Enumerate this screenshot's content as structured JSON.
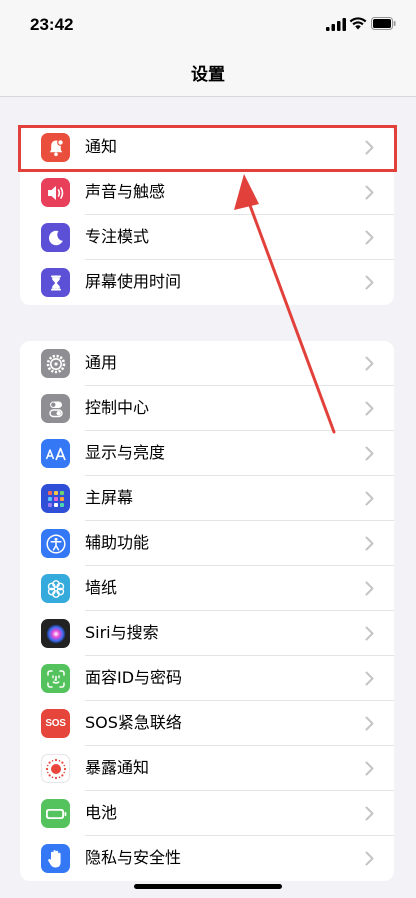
{
  "status_bar": {
    "time": "23:42"
  },
  "nav": {
    "title": "设置"
  },
  "groups": [
    {
      "items": [
        {
          "label": "通知",
          "icon": "bell-icon",
          "color": "#ea4e3d"
        },
        {
          "label": "声音与触感",
          "icon": "speaker-icon",
          "color": "#e8405a"
        },
        {
          "label": "专注模式",
          "icon": "moon-icon",
          "color": "#5b50d6"
        },
        {
          "label": "屏幕使用时间",
          "icon": "hourglass-icon",
          "color": "#5b50d6"
        }
      ]
    },
    {
      "items": [
        {
          "label": "通用",
          "icon": "gear-icon",
          "color": "#8e8e93"
        },
        {
          "label": "控制中心",
          "icon": "toggles-icon",
          "color": "#8e8e93"
        },
        {
          "label": "显示与亮度",
          "icon": "text-size-icon",
          "color": "#3478f6"
        },
        {
          "label": "主屏幕",
          "icon": "home-grid-icon",
          "color": "#2f4fd6"
        },
        {
          "label": "辅助功能",
          "icon": "accessibility-icon",
          "color": "#3478f6"
        },
        {
          "label": "墙纸",
          "icon": "flower-icon",
          "color": "#35aadc"
        },
        {
          "label": "Siri与搜索",
          "icon": "siri-icon",
          "color": "#222222"
        },
        {
          "label": "面容ID与密码",
          "icon": "face-id-icon",
          "color": "#55c35d"
        },
        {
          "label": "SOS紧急联络",
          "icon": "sos-icon",
          "color": "#e5453a",
          "badge": "SOS"
        },
        {
          "label": "暴露通知",
          "icon": "exposure-icon",
          "color": "#ffffff"
        },
        {
          "label": "电池",
          "icon": "battery-icon",
          "color": "#55c35d"
        },
        {
          "label": "隐私与安全性",
          "icon": "hand-icon",
          "color": "#3478f6"
        }
      ]
    }
  ],
  "annotation": {
    "color": "#e1403b"
  }
}
